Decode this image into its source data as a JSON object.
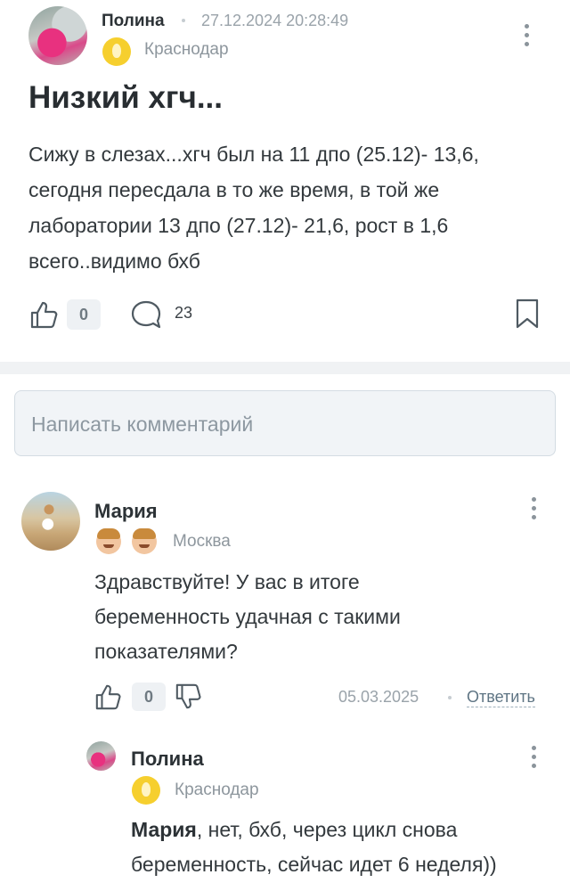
{
  "post": {
    "author": "Полина",
    "date": "27.12.2024 20:28:49",
    "city": "Краснодар",
    "title": "Низкий хгч...",
    "body": "Сижу в слезах...хгч был на 11 дпо (25.12)- 13,6,\nсегодня пересдала в то же время, в той же\nлаборатории 13 дпо (27.12)- 21,6, рост в 1,6\nвсего..видимо бхб",
    "likes": "0",
    "comments": "23",
    "icons": {
      "like": "thumbs-up-icon",
      "comment": "comment-bubble-icon",
      "bookmark": "bookmark-icon",
      "menu": "kebab-menu-icon",
      "badge": "yellow-badge-icon"
    }
  },
  "comment_input": {
    "placeholder": "Написать комментарий"
  },
  "comments": [
    {
      "author": "Мария",
      "city": "Москва",
      "text": "Здравствуйте! У вас в итоге\nбеременность удачная с такими\nпоказателями?",
      "likes": "0",
      "date": "05.03.2025",
      "reply_label": "Ответить",
      "badges": [
        "kid-icon",
        "kid-icon"
      ]
    },
    {
      "author": "Полина",
      "city": "Краснодар",
      "mention": "Мария",
      "text": ", нет, бхб, через цикл снова\nбеременность, сейчас идет 6 неделя))"
    }
  ],
  "colors": {
    "accent_link": "#5f7584",
    "badge": "#f6cf2e",
    "muted": "#9aa3aa"
  }
}
